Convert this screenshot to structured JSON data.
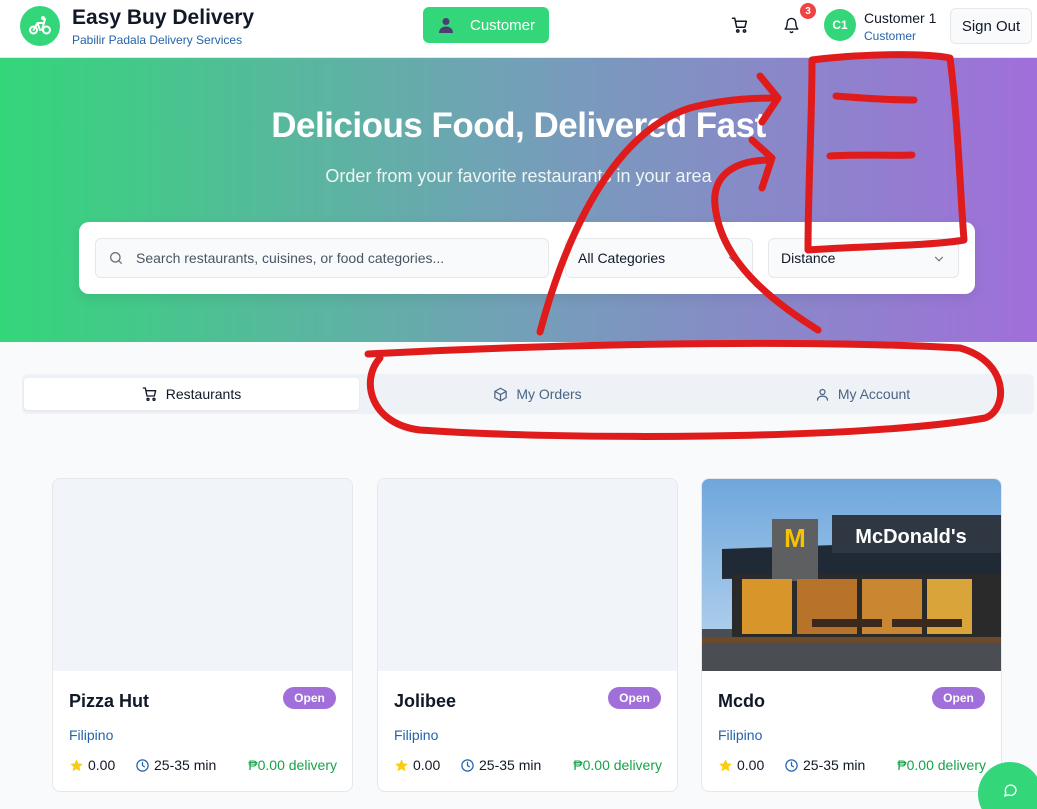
{
  "header": {
    "brand_title": "Easy Buy Delivery",
    "brand_subtitle": "Pabilir Padala Delivery Services",
    "role_button": "Customer",
    "notification_count": "3",
    "avatar_initials": "C1",
    "user_name": "Customer 1",
    "user_role": "Customer",
    "sign_out": "Sign Out"
  },
  "hero": {
    "title": "Delicious Food, Delivered Fast",
    "subtitle": "Order from your favorite restaurants in your area",
    "search_placeholder": "Search restaurants, cuisines, or food categories...",
    "category_select": "All Categories",
    "sort_select": "Distance"
  },
  "tabs": [
    {
      "label": "Restaurants",
      "icon": "cart-icon",
      "active": true
    },
    {
      "label": "My Orders",
      "icon": "package-icon",
      "active": false
    },
    {
      "label": "My Account",
      "icon": "user-icon",
      "active": false
    }
  ],
  "restaurants": [
    {
      "name": "Pizza Hut",
      "status": "Open",
      "cuisine": "Filipino",
      "rating": "0.00",
      "time": "25-35 min",
      "fee": "₱0.00 delivery",
      "image": "placeholder"
    },
    {
      "name": "Jolibee",
      "status": "Open",
      "cuisine": "Filipino",
      "rating": "0.00",
      "time": "25-35 min",
      "fee": "₱0.00 delivery",
      "image": "placeholder"
    },
    {
      "name": "Mcdo",
      "status": "Open",
      "cuisine": "Filipino",
      "rating": "0.00",
      "time": "25-35 min",
      "fee": "₱0.00 delivery",
      "image": "mcdonalds-storefront-photo",
      "image_sign": "McDonald's"
    }
  ],
  "colors": {
    "accent_green": "#34d67a",
    "accent_purple": "#a06fda",
    "link_blue": "#2563a8",
    "fee_green": "#16a34a",
    "annotation_red": "#e01b1b"
  },
  "icons": {
    "logo": "bicycle-icon",
    "role": "person-icon",
    "cart": "cart-icon",
    "notifications": "bell-icon",
    "search": "search-icon",
    "chevron": "chevron-down-icon",
    "star": "star-icon",
    "clock": "clock-icon",
    "chat": "chat-icon"
  }
}
